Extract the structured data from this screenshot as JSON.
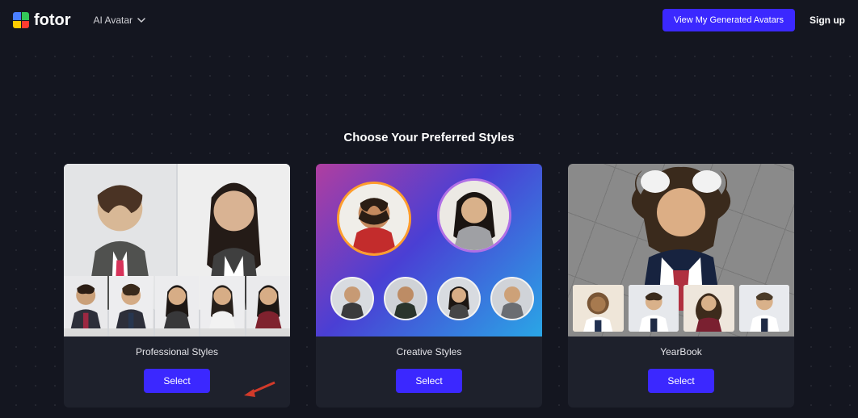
{
  "header": {
    "brand": "fotor",
    "nav_label": "AI Avatar",
    "view_avatars_label": "View My Generated Avatars",
    "signup_label": "Sign up"
  },
  "page": {
    "title": "Choose Your Preferred Styles"
  },
  "styles": [
    {
      "id": "professional",
      "title": "Professional Styles",
      "select_label": "Select"
    },
    {
      "id": "creative",
      "title": "Creative Styles",
      "select_label": "Select"
    },
    {
      "id": "yearbook",
      "title": "YearBook",
      "select_label": "Select"
    }
  ],
  "colors": {
    "primary": "#3b28ff"
  }
}
